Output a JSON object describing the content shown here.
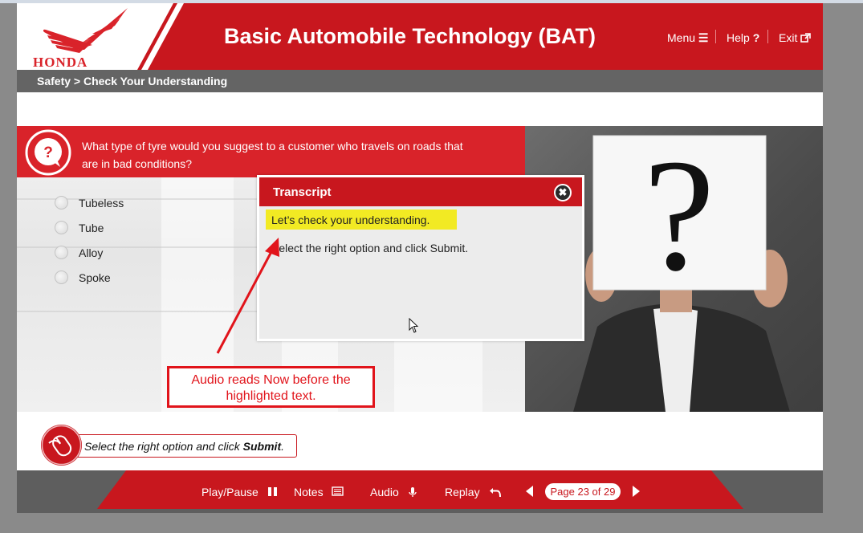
{
  "header": {
    "brand": "HONDA",
    "course_title": "Basic Automobile Technology (BAT)",
    "menu_label": "Menu",
    "help_label": "Help",
    "exit_label": "Exit"
  },
  "breadcrumb": "Safety > Check Your Understanding",
  "question": {
    "text": "What type of tyre would you suggest to a customer who travels on roads that are in bad conditions?",
    "options": [
      "Tubeless",
      "Tube",
      "Alloy",
      "Spoke"
    ]
  },
  "transcript": {
    "title": "Transcript",
    "line1": "Let’s check your understanding.",
    "line2": "Select the right option and click Submit."
  },
  "annotation": {
    "text": "Audio reads Now before the highlighted text."
  },
  "instruction": {
    "prefix": "Select the right option and click ",
    "bold": "Submit",
    "suffix": "."
  },
  "footer": {
    "play_pause": "Play/Pause",
    "notes": "Notes",
    "audio": "Audio",
    "replay": "Replay",
    "page_indicator": "Page 23 of 29"
  },
  "colors": {
    "brand_red": "#c8171e",
    "question_red": "#d9232a",
    "highlight_yellow": "#f2ea23",
    "annotation_red": "#e1141b",
    "footer_gray": "#5e5e5e"
  }
}
